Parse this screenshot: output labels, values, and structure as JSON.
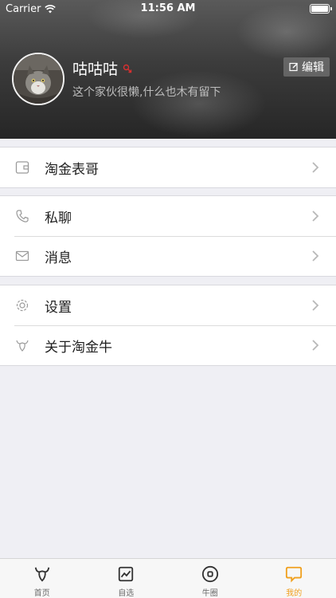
{
  "status": {
    "carrier": "Carrier",
    "time": "11:56 AM"
  },
  "profile": {
    "name": "咕咕咕",
    "bio": "这个家伙很懒,什么也木有留下",
    "edit_label": "编辑"
  },
  "menu": {
    "group1": [
      {
        "label": "淘金表哥",
        "icon": "wallet-icon"
      }
    ],
    "group2": [
      {
        "label": "私聊",
        "icon": "phone-icon"
      },
      {
        "label": "消息",
        "icon": "envelope-icon"
      }
    ],
    "group3": [
      {
        "label": "设置",
        "icon": "gear-icon"
      },
      {
        "label": "关于淘金牛",
        "icon": "bull-heart-icon"
      }
    ]
  },
  "tabs": [
    {
      "label": "首页",
      "icon": "bull-icon"
    },
    {
      "label": "自选",
      "icon": "chart-icon"
    },
    {
      "label": "牛圈",
      "icon": "circle-icon"
    },
    {
      "label": "我的",
      "icon": "chat-bubble-icon",
      "active": true
    }
  ],
  "colors": {
    "accent": "#f0a01e",
    "background": "#efeff4",
    "gender_icon": "#d93030"
  }
}
